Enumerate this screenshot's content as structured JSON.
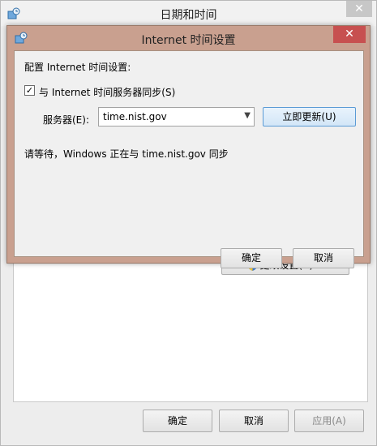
{
  "background_window": {
    "title": "日期和时间",
    "close_glyph": "✕",
    "change_settings_label": "更改设置(C)...",
    "ok_label": "确定",
    "cancel_label": "取消",
    "apply_label": "应用(A)"
  },
  "dialog": {
    "title": "Internet 时间设置",
    "close_glyph": "✕",
    "heading": "配置 Internet 时间设置:",
    "sync_checkbox": {
      "label": "与 Internet 时间服务器同步(S)",
      "checked": true,
      "check_glyph": "✓"
    },
    "server_label": "服务器(E):",
    "server_value": "time.nist.gov",
    "dropdown_glyph": "▼",
    "update_now_label": "立即更新(U)",
    "status_text": "请等待，Windows 正在与 time.nist.gov 同步",
    "ok_label": "确定",
    "cancel_label": "取消"
  },
  "colors": {
    "dialog_frame": "#c9a08f",
    "close_button": "#c75050",
    "focused_button_border": "#5b9bd5"
  },
  "icons": [
    "clock-app-icon",
    "uac-shield-icon",
    "close-icon",
    "chevron-down-icon"
  ]
}
